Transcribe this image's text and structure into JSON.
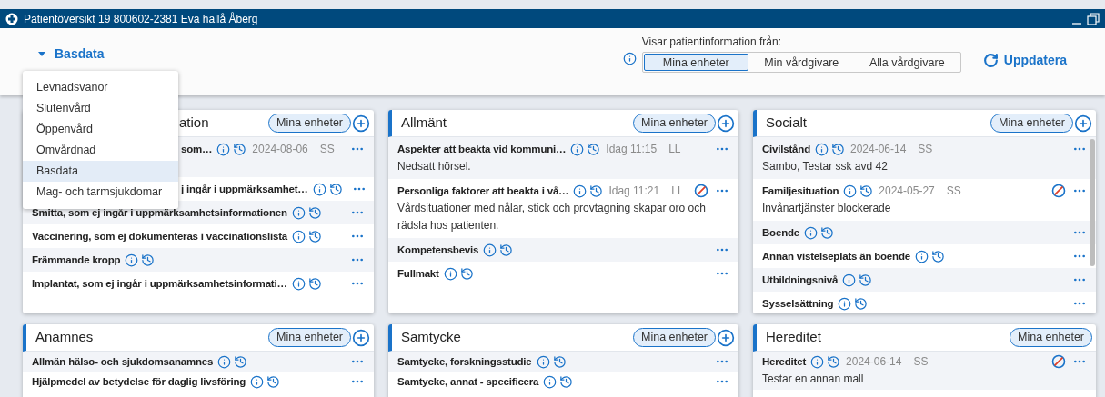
{
  "window": {
    "title": "Patientöversikt 19 800602-2381 Eva hallå Åberg"
  },
  "view_menu": {
    "label": "Basdata",
    "expanded": true,
    "items": [
      {
        "label": "Levnadsvanor",
        "selected": false
      },
      {
        "label": "Slutenvård",
        "selected": false
      },
      {
        "label": "Öppenvård",
        "selected": false
      },
      {
        "label": "Omvårdnad",
        "selected": false
      },
      {
        "label": "Basdata",
        "selected": true
      },
      {
        "label": "Mag- och tarmsjukdomar",
        "selected": false
      }
    ]
  },
  "source_filter": {
    "label": "Visar patientinformation från:",
    "options": [
      {
        "label": "Mina enheter",
        "selected": true
      },
      {
        "label": "Min vårdgivare",
        "selected": false
      },
      {
        "label": "Alla vårdgivare",
        "selected": false
      }
    ]
  },
  "refresh_button": "Uppdatera",
  "cards": [
    {
      "title": "ation",
      "filter": "Mina enheter",
      "addable": true,
      "scrollable": false,
      "rows": [
        {
          "title": "som…",
          "date": "2024-08-06",
          "user": "SS",
          "blocked": false
        },
        {
          "title": "j ingår i uppmärksamhet…",
          "blocked": false
        },
        {
          "title": "Smitta, som ej ingår i uppmärksamhetsinformationen",
          "blocked": false
        },
        {
          "title": "Vaccinering, som ej dokumenteras i vaccinationslista",
          "blocked": false
        },
        {
          "title": "Främmande kropp",
          "blocked": false
        },
        {
          "title": "Implantat, som ej ingår i uppmärksamhetsinformati…",
          "blocked": false
        }
      ]
    },
    {
      "title": "Allmänt",
      "filter": "Mina enheter",
      "addable": true,
      "scrollable": false,
      "rows": [
        {
          "title": "Aspekter att beakta vid kommuni…",
          "date": "Idag 11:15",
          "user": "LL",
          "blocked": false,
          "text": "Nedsatt hörsel."
        },
        {
          "title": "Personliga faktorer att beakta i vå…",
          "date": "Idag 11:21",
          "user": "LL",
          "blocked": true,
          "text": "Vårdsituationer med nålar, stick och provtagning skapar oro och rädsla hos patienten."
        },
        {
          "title": "Kompetensbevis",
          "blocked": false
        },
        {
          "title": "Fullmakt",
          "blocked": false
        }
      ]
    },
    {
      "title": "Socialt",
      "filter": "Mina enheter",
      "addable": true,
      "scrollable": true,
      "rows": [
        {
          "title": "Civilstånd",
          "date": "2024-06-14",
          "user": "SS",
          "blocked": false,
          "text": "Sambo, Testar ssk avd 42"
        },
        {
          "title": "Familjesituation",
          "date": "2024-05-27",
          "user": "SS",
          "blocked": true,
          "text": "Invånartjänster blockerade"
        },
        {
          "title": "Boende",
          "blocked": false
        },
        {
          "title": "Annan vistelseplats än boende",
          "blocked": false
        },
        {
          "title": "Utbildningsnivå",
          "blocked": false
        },
        {
          "title": "Sysselsättning",
          "blocked": false
        }
      ]
    },
    {
      "title": "Anamnes",
      "filter": "Mina enheter",
      "addable": true,
      "scrollable": false,
      "rows": [
        {
          "title": "Allmän hälso- och sjukdomsanamnes",
          "blocked": false
        },
        {
          "title": "Hjälpmedel av betydelse för daglig livsföring",
          "blocked": false
        }
      ]
    },
    {
      "title": "Samtycke",
      "filter": "Mina enheter",
      "addable": true,
      "scrollable": false,
      "rows": [
        {
          "title": "Samtycke, forskningsstudie",
          "blocked": false
        },
        {
          "title": "Samtycke, annat - specificera",
          "blocked": false
        }
      ]
    },
    {
      "title": "Hereditet",
      "filter": "Mina enheter",
      "addable": false,
      "scrollable": false,
      "rows": [
        {
          "title": "Hereditet",
          "date": "2024-06-14",
          "user": "SS",
          "blocked": true,
          "text": "Testar en annan mall"
        }
      ]
    }
  ]
}
